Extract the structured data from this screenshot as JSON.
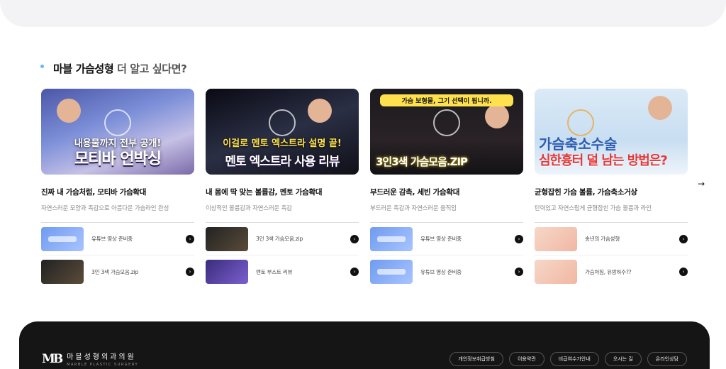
{
  "section": {
    "title_strong": "마블 가슴성형",
    "title_soft": "더 알고 싶다면?"
  },
  "cards": [
    {
      "thumb_top": "내용물까지 전부 공개!",
      "thumb_bottom": "모티바 언박싱",
      "title": "진짜 내 가슴처럼, 모티바 가슴확대",
      "desc": "자연스러운 모양과 촉감으로 아름다운 가슴라인 완성",
      "items": [
        {
          "label": "유튜브 영상 준비중",
          "thumb": "pending"
        },
        {
          "label": "3인 3색 가슴모음.zip",
          "thumb": "dark"
        }
      ]
    },
    {
      "thumb_top": "이걸로 멘토 엑스트라 설명 끝!",
      "thumb_bottom": "멘토 엑스트라 사용 리뷰",
      "title": "내 몸에 딱 맞는 볼륨감, 멘토 가슴확대",
      "desc": "이상적인 볼륨감과 자연스러운 촉감",
      "items": [
        {
          "label": "3인 3색 가슴모음.zip",
          "thumb": "dark"
        },
        {
          "label": "멘토 부스트 리뷰",
          "thumb": "purple"
        }
      ]
    },
    {
      "thumb_top": "가슴 보형물, 그기 선택이 됩니까.",
      "thumb_bottom": "3인3색 가슴모음.ZIP",
      "title": "부드러운 감촉, 세빈 가슴확대",
      "desc": "부드러운 촉감과 자연스러운 움직임",
      "items": [
        {
          "label": "유튜브 영상 준비중",
          "thumb": "pending"
        },
        {
          "label": "유튜브 영상 준비중",
          "thumb": "pending"
        }
      ]
    },
    {
      "thumb_top": "가슴축소수술",
      "thumb_bottom": "심한흉터 덜 남는 방법은?",
      "title": "균형잡힌 가슴 볼륨, 가슴축소거상",
      "desc": "탄력있고 자연스럽게 균형잡힌 가슴 볼륨과 라인",
      "items": [
        {
          "label": "송년의 가슴성형",
          "thumb": "light"
        },
        {
          "label": "가슴처짐, 유방하수??",
          "thumb": "light"
        }
      ]
    }
  ],
  "next_arrow": "→",
  "row_arrow": "›",
  "footer": {
    "logo_mark": "MB",
    "logo_ko": "마블성형외과의원",
    "logo_en": "MARBLE PLASTIC SURGERY",
    "links": [
      "개인정보취급방침",
      "이용약관",
      "비급여수가안내",
      "오시는 길",
      "온라인상담"
    ]
  }
}
